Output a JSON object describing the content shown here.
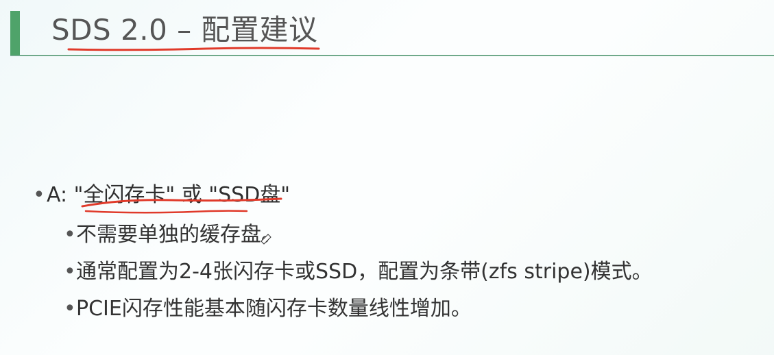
{
  "slide": {
    "title": "SDS 2.0 – 配置建议",
    "bullets": [
      {
        "marker": "•",
        "text": "A: \"全闪存卡\" 或 \"SSD盘\"",
        "children": [
          {
            "marker": "•",
            "text": "不需要单独的缓存盘。"
          },
          {
            "marker": "•",
            "text": "通常配置为2-4张闪存卡或SSD，配置为条带(zfs stripe)模式。"
          },
          {
            "marker": "•",
            "text": "PCIE闪存性能基本随闪存卡数量线性增加。"
          }
        ]
      }
    ]
  },
  "colors": {
    "accent_bar": "#4fa36a",
    "title_rule": "#6fa98a",
    "annotation_ink": "#e03a2a"
  }
}
